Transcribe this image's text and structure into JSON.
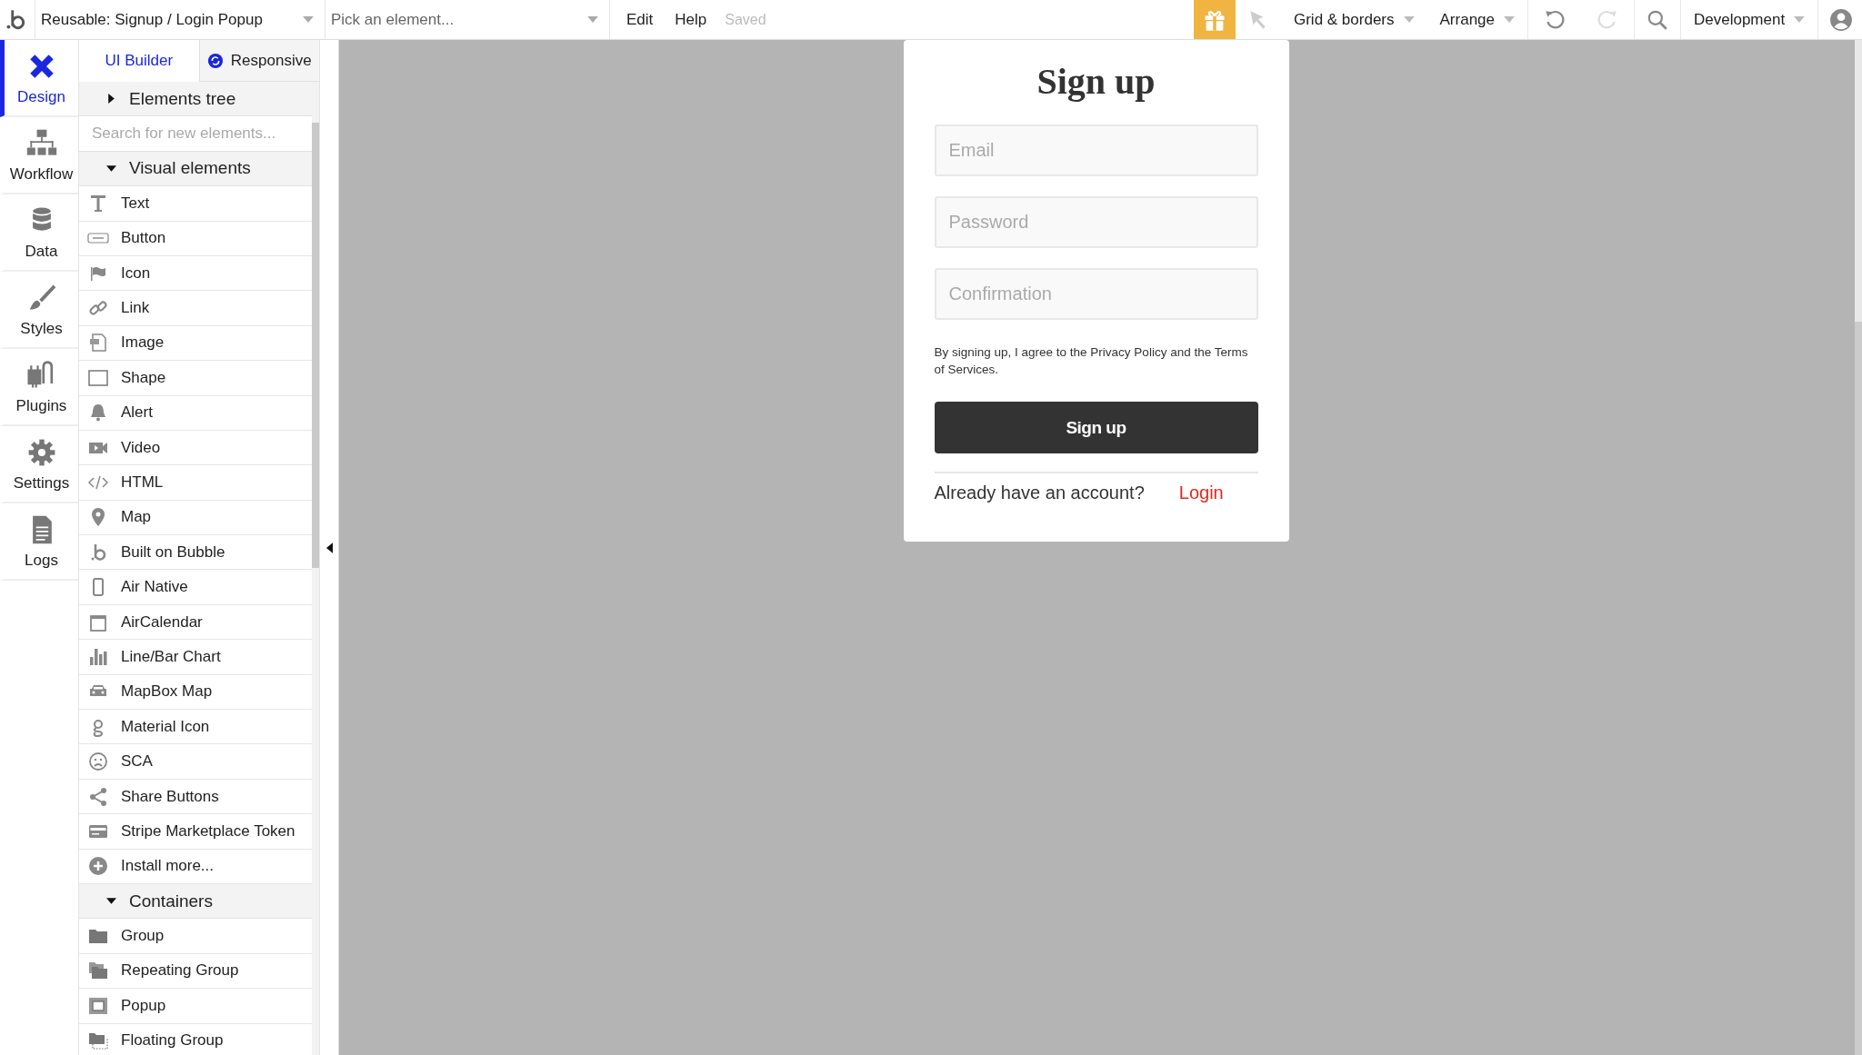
{
  "top_bar": {
    "page_selector": "Reusable: Signup / Login Popup",
    "element_picker": {
      "placeholder": "Pick an element..."
    },
    "menu": [
      "Edit",
      "Help"
    ],
    "save_status": "Saved",
    "grid_menu": "Grid & borders",
    "arrange_menu": "Arrange",
    "undo": {
      "disabled": false
    },
    "redo": {
      "disabled": true
    },
    "environment": "Development"
  },
  "nav": [
    {
      "label": "Design",
      "selected": true
    },
    {
      "label": "Workflow",
      "selected": false
    },
    {
      "label": "Data",
      "selected": false
    },
    {
      "label": "Styles",
      "selected": false
    },
    {
      "label": "Plugins",
      "selected": false
    },
    {
      "label": "Settings",
      "selected": false
    },
    {
      "label": "Logs",
      "selected": false
    }
  ],
  "panel_tabs": [
    {
      "label": "UI Builder",
      "selected": true
    },
    {
      "label": "Responsive",
      "selected": false
    }
  ],
  "elements_tree": {
    "title": "Elements tree",
    "expanded": false
  },
  "search": {
    "placeholder": "Search for new elements..."
  },
  "groups": [
    {
      "title": "Visual elements",
      "expanded": true,
      "items": [
        "Text",
        "Button",
        "Icon",
        "Link",
        "Image",
        "Shape",
        "Alert",
        "Video",
        "HTML",
        "Map",
        "Built on Bubble",
        "Air Native",
        "AirCalendar",
        "Line/Bar Chart",
        "MapBox Map",
        "Material Icon",
        "SCA",
        "Share Buttons",
        "Stripe Marketplace Token",
        "Install more..."
      ]
    },
    {
      "title": "Containers",
      "expanded": true,
      "items": [
        "Group",
        "Repeating Group",
        "Popup",
        "Floating Group"
      ]
    }
  ],
  "popup": {
    "title": "Sign up",
    "fields": [
      {
        "placeholder": "Email"
      },
      {
        "placeholder": "Password"
      },
      {
        "placeholder": "Confirmation"
      }
    ],
    "terms": "By signing up, I agree to the Privacy Policy and the Terms of Services.",
    "submit": "Sign up",
    "prompt": "Already have an account?",
    "login_link": "Login"
  }
}
